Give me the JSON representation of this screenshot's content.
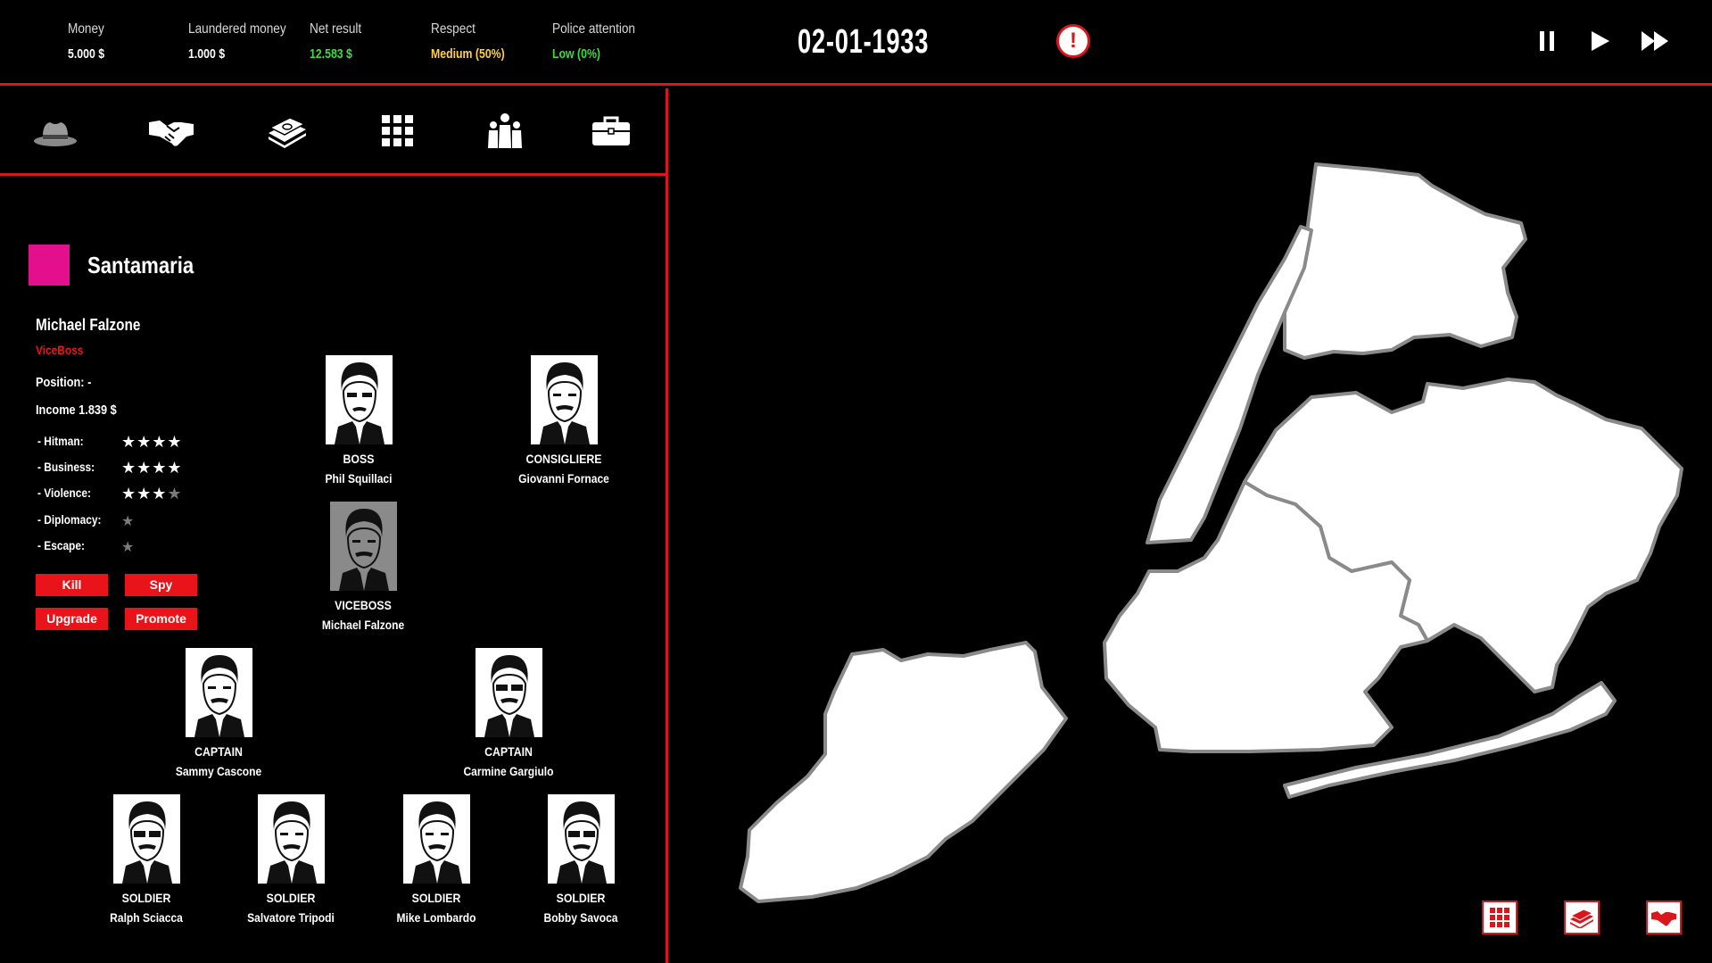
{
  "header": {
    "stats": [
      {
        "label": "Money",
        "value": "5.000 $",
        "color": "#ffffff"
      },
      {
        "label": "Laundered money",
        "value": "1.000 $",
        "color": "#ffffff"
      },
      {
        "label": "Net result",
        "value": "12.583 $",
        "color": "#3ddc3d"
      },
      {
        "label": "Respect",
        "value": "Medium (50%)",
        "color": "#ffd23c"
      },
      {
        "label": "Police attention",
        "value": "Low (0%)",
        "color": "#3ddc3d"
      }
    ],
    "date": "02-01-1933",
    "alert_symbol": "!",
    "time_controls": [
      "pause-icon",
      "play-icon",
      "fast-forward-icon"
    ]
  },
  "tabs": [
    "fedora-hat-icon",
    "handshake-icon",
    "money-stack-icon",
    "grid-icon",
    "crew-icon",
    "briefcase-icon"
  ],
  "family": {
    "name": "Santamaria",
    "color": "#e40f8c"
  },
  "selected": {
    "name": "Michael Falzone",
    "role": "ViceBoss",
    "position": "Position: -",
    "income": "Income 1.839 $",
    "skills": [
      {
        "label": "- Hitman:",
        "stars": 4,
        "max": 4
      },
      {
        "label": "- Business:",
        "stars": 4,
        "max": 4
      },
      {
        "label": "- Violence:",
        "stars": 3,
        "max": 4
      },
      {
        "label": "- Diplomacy:",
        "stars": 0,
        "max": 1
      },
      {
        "label": "- Escape:",
        "stars": 0,
        "max": 1
      }
    ],
    "actions": [
      "Kill",
      "Spy",
      "Upgrade",
      "Promote"
    ]
  },
  "members": [
    {
      "rank": "BOSS",
      "name": "Phil Squillaci"
    },
    {
      "rank": "CONSIGLIERE",
      "name": "Giovanni Fornace"
    },
    {
      "rank": "VICEBOSS",
      "name": "Michael Falzone"
    },
    {
      "rank": "CAPTAIN",
      "name": "Sammy Cascone"
    },
    {
      "rank": "CAPTAIN",
      "name": "Carmine Gargiulo"
    },
    {
      "rank": "SOLDIER",
      "name": "Ralph Sciacca"
    },
    {
      "rank": "SOLDIER",
      "name": "Salvatore Tripodi"
    },
    {
      "rank": "SOLDIER",
      "name": "Mike Lombardo"
    },
    {
      "rank": "SOLDIER",
      "name": "Bobby Savoca"
    }
  ],
  "map_buttons": [
    "grid-icon",
    "money-icon",
    "handshake-icon"
  ],
  "colors": {
    "accent": "#d9161b",
    "background": "#000000",
    "family": "#e40f8c"
  }
}
